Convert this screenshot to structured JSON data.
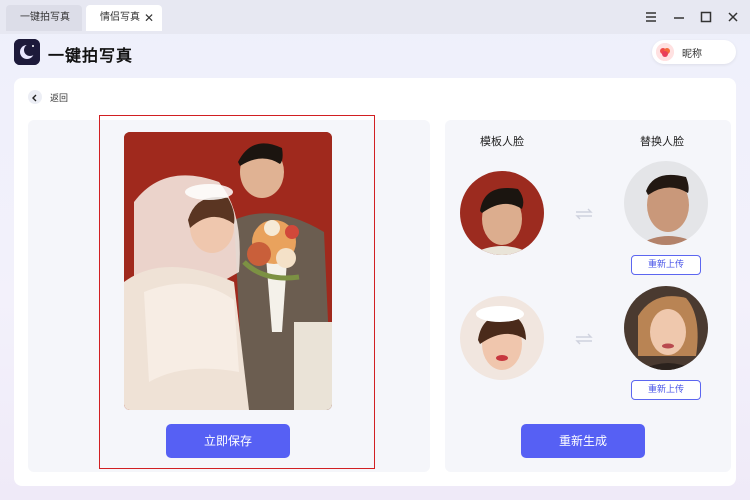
{
  "tabs": [
    {
      "label": "一键拍写真",
      "active": false
    },
    {
      "label": "情侣写真",
      "active": true
    }
  ],
  "tab_close_label": "✕",
  "app": {
    "title": "一键拍写真"
  },
  "user": {
    "name": "昵称"
  },
  "back": {
    "label": "返回"
  },
  "result": {
    "save_label": "立即保存"
  },
  "faces": {
    "template_header": "模板人脸",
    "replace_header": "替换人脸",
    "reupload_label": "重新上传",
    "regenerate_label": "重新生成"
  },
  "colors": {
    "accent": "#5660f4",
    "highlight_frame": "#d11f22",
    "photo_background": "#9b2a1e"
  }
}
